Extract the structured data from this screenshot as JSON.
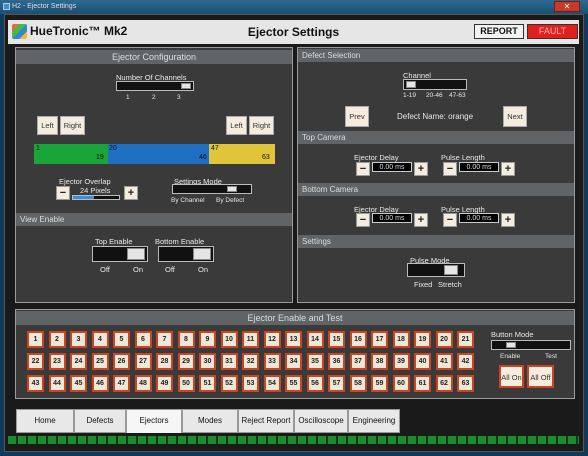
{
  "window": {
    "title": "H2 - Ejector Settings",
    "close": "✕"
  },
  "header": {
    "app_name": "HueTronic™ Mk2",
    "title": "Ejector Settings",
    "report": "REPORT",
    "fault": "FAULT",
    "colors": {
      "fault": "#e0201e"
    }
  },
  "ejector_config": {
    "title": "Ejector Configuration",
    "channels_label": "Number Of Channels",
    "channel_ticks": [
      "1",
      "2",
      "3"
    ],
    "channel_value": 3,
    "left_btn": "Left",
    "right_btn": "Right",
    "ranges": [
      {
        "start": "1",
        "end": "19",
        "color": "#1aa53a"
      },
      {
        "start": "20",
        "end": "46",
        "color": "#1f6fc2"
      },
      {
        "start": "47",
        "end": "63",
        "color": "#e0c43a"
      }
    ],
    "overlap_label": "Ejector Overlap",
    "overlap_value": "24 Pixels",
    "overlap_fraction": 0.45,
    "settings_mode_label": "Settings Mode",
    "settings_mode_options": [
      "By Channel",
      "By Defect"
    ],
    "settings_mode_selected": "By Defect"
  },
  "view_enable": {
    "title": "View Enable",
    "top_label": "Top Enable",
    "bottom_label": "Bottom Enable",
    "off": "Off",
    "on": "On",
    "top_state": "On",
    "bottom_state": "On"
  },
  "defect_selection": {
    "title": "Defect Selection",
    "channel_label": "Channel",
    "channel_ticks": [
      "1-19",
      "20-46",
      "47-63"
    ],
    "channel_selected": "1-19",
    "prev": "Prev",
    "next": "Next",
    "defect_name": "Defect Name: orange"
  },
  "top_camera": {
    "title": "Top Camera",
    "delay_label": "Ejector Delay",
    "delay_value": "0.00 ms",
    "pulse_label": "Pulse Length",
    "pulse_value": "0.00 ms"
  },
  "bottom_camera": {
    "title": "Bottom Camera",
    "delay_label": "Ejector Delay",
    "delay_value": "0.00 ms",
    "pulse_label": "Pulse Length",
    "pulse_value": "0.00 ms"
  },
  "settings": {
    "title": "Settings",
    "pulse_mode_label": "Pulse Mode",
    "options": [
      "Fixed",
      "Stretch"
    ],
    "selected": "Stretch"
  },
  "ejector_test": {
    "title": "Ejector Enable and Test",
    "buttons": [
      "1",
      "2",
      "3",
      "4",
      "5",
      "6",
      "7",
      "8",
      "9",
      "10",
      "11",
      "12",
      "13",
      "14",
      "15",
      "16",
      "17",
      "18",
      "19",
      "20",
      "21",
      "22",
      "23",
      "24",
      "25",
      "26",
      "27",
      "28",
      "29",
      "30",
      "31",
      "32",
      "33",
      "34",
      "35",
      "36",
      "37",
      "38",
      "39",
      "40",
      "41",
      "42",
      "43",
      "44",
      "45",
      "46",
      "47",
      "48",
      "49",
      "50",
      "51",
      "52",
      "53",
      "54",
      "55",
      "56",
      "57",
      "58",
      "59",
      "60",
      "61",
      "62",
      "63"
    ],
    "button_mode_label": "Button Mode",
    "button_mode_options": [
      "Enable",
      "Test"
    ],
    "button_mode_selected": "Enable",
    "all_on": "All On",
    "all_off": "All Off"
  },
  "tabs": [
    "Home",
    "Defects",
    "Ejectors",
    "Modes",
    "Reject Report",
    "Oscilloscope",
    "Engineering"
  ],
  "active_tab": "Ejectors",
  "minus": "−",
  "plus": "+"
}
